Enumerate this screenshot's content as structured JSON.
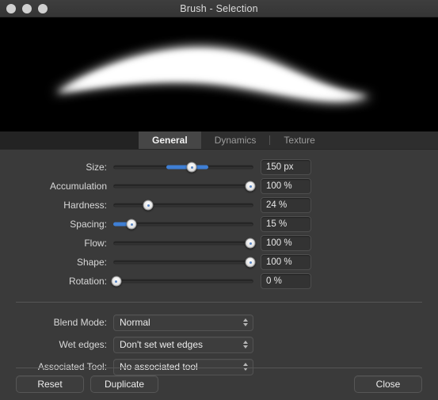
{
  "window": {
    "title": "Brush - Selection",
    "controls": [
      {
        "name": "close-button"
      },
      {
        "name": "minimize-button"
      },
      {
        "name": "zoom-button"
      }
    ]
  },
  "preview": {
    "alt": "brush-stroke-preview",
    "background_color": "#000000",
    "stroke_color": "#ffffff"
  },
  "tabs": [
    {
      "label": "General",
      "active": true
    },
    {
      "label": "Dynamics",
      "active": false
    },
    {
      "label": "Texture",
      "active": false
    }
  ],
  "sliders": [
    {
      "label": "Size:",
      "value": "150 px",
      "percent": 56,
      "fill_from": 38,
      "fill_to": 68
    },
    {
      "label": "Accumulation",
      "value": "100 %",
      "percent": 100,
      "fill_from": 0,
      "fill_to": 0
    },
    {
      "label": "Hardness:",
      "value": "24 %",
      "percent": 24,
      "fill_from": 0,
      "fill_to": 0
    },
    {
      "label": "Spacing:",
      "value": "15 %",
      "percent": 13,
      "fill_from": 0,
      "fill_to": 13
    },
    {
      "label": "Flow:",
      "value": "100 %",
      "percent": 100,
      "fill_from": 0,
      "fill_to": 0
    },
    {
      "label": "Shape:",
      "value": "100 %",
      "percent": 100,
      "fill_from": 0,
      "fill_to": 0
    },
    {
      "label": "Rotation:",
      "value": "0 %",
      "percent": 0,
      "fill_from": 0,
      "fill_to": 0
    }
  ],
  "dropdowns": [
    {
      "label": "Blend Mode:",
      "value": "Normal"
    },
    {
      "label": "Wet edges:",
      "value": "Don't set wet edges"
    },
    {
      "label": "Associated Tool:",
      "value": "No associated tool"
    }
  ],
  "footer": {
    "reset_label": "Reset",
    "duplicate_label": "Duplicate",
    "close_label": "Close"
  },
  "colors": {
    "accent": "#3f7fd4",
    "window_bg": "#3a3a3a",
    "titlebar_bg": "#3a3a3a",
    "tab_active_bg": "#464646"
  }
}
